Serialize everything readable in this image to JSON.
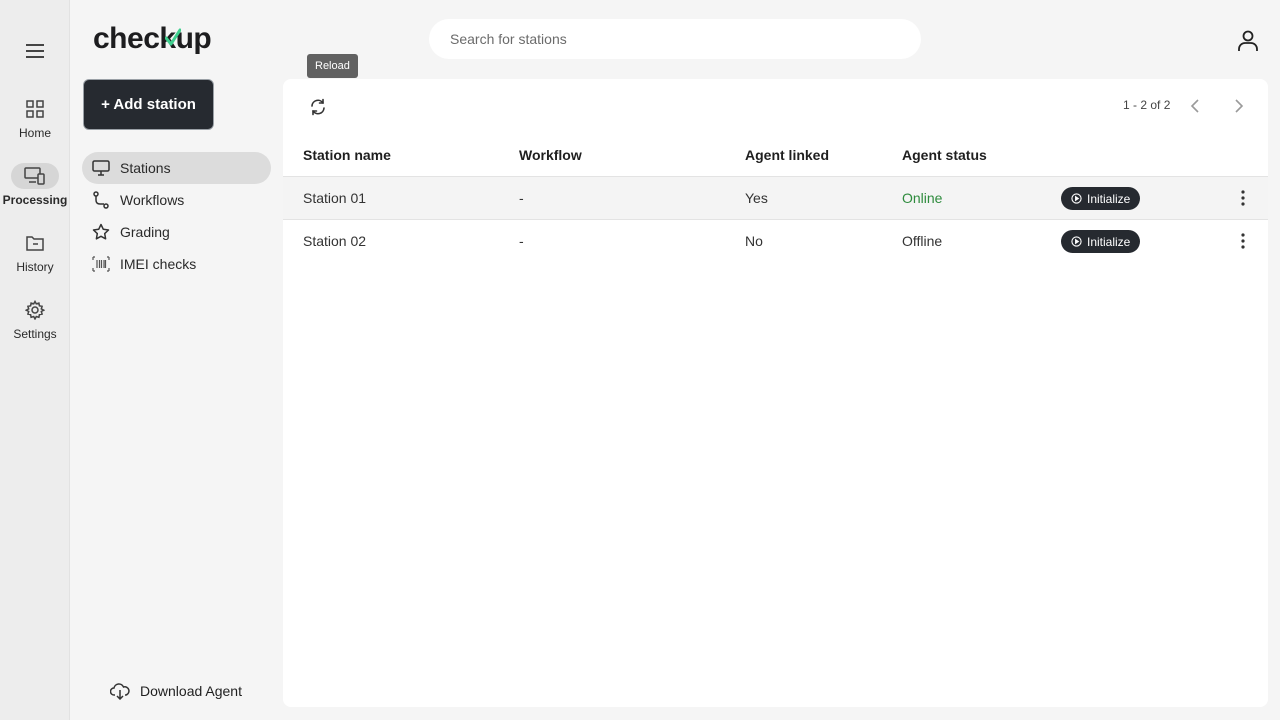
{
  "app": {
    "logo": "checkup"
  },
  "rail": {
    "items": [
      {
        "label": "Home",
        "icon": "grid-icon"
      },
      {
        "label": "Processing",
        "icon": "devices-icon",
        "active": true
      },
      {
        "label": "History",
        "icon": "folder-icon"
      },
      {
        "label": "Settings",
        "icon": "gear-icon"
      }
    ]
  },
  "subnav": {
    "add_label": "+ Add station",
    "items": [
      {
        "label": "Stations",
        "icon": "monitor-icon",
        "active": true
      },
      {
        "label": "Workflows",
        "icon": "route-icon"
      },
      {
        "label": "Grading",
        "icon": "star-icon"
      },
      {
        "label": "IMEI checks",
        "icon": "barcode-icon"
      }
    ],
    "download_label": "Download Agent"
  },
  "search": {
    "placeholder": "Search for stations"
  },
  "toolbar": {
    "tooltip": "Reload",
    "pager": "1 - 2 of 2"
  },
  "table": {
    "columns": [
      "Station name",
      "Workflow",
      "Agent linked",
      "Agent status"
    ],
    "rows": [
      {
        "name": "Station 01",
        "workflow": "-",
        "linked": "Yes",
        "status": "Online",
        "action": "Initialize"
      },
      {
        "name": "Station 02",
        "workflow": "-",
        "linked": "No",
        "status": "Offline",
        "action": "Initialize"
      }
    ]
  },
  "colors": {
    "accent": "#262a30",
    "online": "#2e8b3d",
    "brand_check": "#3ecf8e"
  }
}
